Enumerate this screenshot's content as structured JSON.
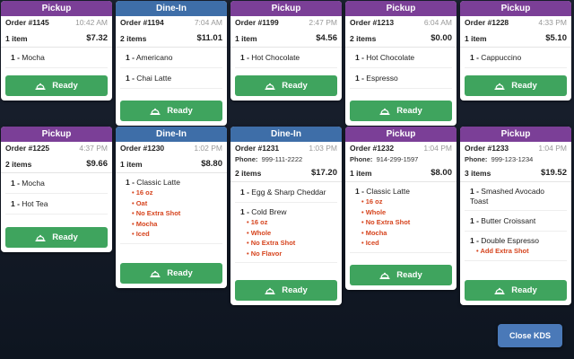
{
  "colors": {
    "pickup": "#7b3f97",
    "dine_in": "#3e6ea8",
    "ready": "#3fa45e",
    "modifier": "#d6451f",
    "close": "#4a79b8"
  },
  "ready_icon": "service-bell-icon",
  "orders": [
    {
      "type": "Pickup",
      "number": "Order #1145",
      "time": "10:42 AM",
      "count": "1 item",
      "total": "$7.32",
      "items": [
        {
          "qty": "1 -",
          "name": "Mocha"
        }
      ]
    },
    {
      "type": "Dine-In",
      "number": "Order #1194",
      "time": "7:04 AM",
      "count": "2 items",
      "total": "$11.01",
      "items": [
        {
          "qty": "1 -",
          "name": "Americano"
        },
        {
          "qty": "1 -",
          "name": "Chai Latte"
        }
      ]
    },
    {
      "type": "Pickup",
      "number": "Order #1199",
      "time": "2:47 PM",
      "count": "1 item",
      "total": "$4.56",
      "items": [
        {
          "qty": "1 -",
          "name": "Hot Chocolate"
        }
      ]
    },
    {
      "type": "Pickup",
      "number": "Order #1213",
      "time": "6:04 AM",
      "count": "2 items",
      "total": "$0.00",
      "items": [
        {
          "qty": "1 -",
          "name": "Hot Chocolate"
        },
        {
          "qty": "1 -",
          "name": "Espresso"
        }
      ]
    },
    {
      "type": "Pickup",
      "number": "Order #1228",
      "time": "4:33 PM",
      "count": "1 item",
      "total": "$5.10",
      "items": [
        {
          "qty": "1 -",
          "name": "Cappuccino"
        }
      ]
    },
    {
      "type": "Pickup",
      "number": "Order #1225",
      "time": "4:37 PM",
      "count": "2 items",
      "total": "$9.66",
      "items": [
        {
          "qty": "1 -",
          "name": "Mocha"
        },
        {
          "qty": "1 -",
          "name": "Hot Tea"
        }
      ]
    },
    {
      "type": "Dine-In",
      "number": "Order #1230",
      "time": "1:02 PM",
      "count": "1 item",
      "total": "$8.80",
      "items": [
        {
          "qty": "1 -",
          "name": "Classic Latte",
          "mods": [
            "16 oz",
            "Oat",
            "No Extra Shot",
            "Mocha",
            "Iced"
          ]
        }
      ]
    },
    {
      "type": "Dine-In",
      "number": "Order #1231",
      "time": "1:03 PM",
      "phone_label": "Phone:",
      "phone": "999-111-2222",
      "count": "2 items",
      "total": "$17.20",
      "items": [
        {
          "qty": "1 -",
          "name": "Egg & Sharp Cheddar"
        },
        {
          "qty": "1 -",
          "name": "Cold Brew",
          "mods": [
            "16 oz",
            "Whole",
            "No Extra Shot",
            "No Flavor"
          ]
        }
      ]
    },
    {
      "type": "Pickup",
      "number": "Order #1232",
      "time": "1:04 PM",
      "phone_label": "Phone:",
      "phone": "914-299-1597",
      "count": "1 item",
      "total": "$8.00",
      "items": [
        {
          "qty": "1 -",
          "name": "Classic Latte",
          "mods": [
            "16 oz",
            "Whole",
            "No Extra Shot",
            "Mocha",
            "Iced"
          ]
        }
      ]
    },
    {
      "type": "Pickup",
      "number": "Order #1233",
      "time": "1:04 PM",
      "phone_label": "Phone:",
      "phone": "999-123-1234",
      "count": "3 items",
      "total": "$19.52",
      "items": [
        {
          "qty": "1 -",
          "name": "Smashed Avocado Toast"
        },
        {
          "qty": "1 -",
          "name": "Butter Croissant"
        },
        {
          "qty": "1 -",
          "name": "Double Espresso",
          "mods": [
            "Add Extra Shot"
          ]
        }
      ]
    }
  ],
  "ready_label": "Ready",
  "close_label": "Close KDS"
}
